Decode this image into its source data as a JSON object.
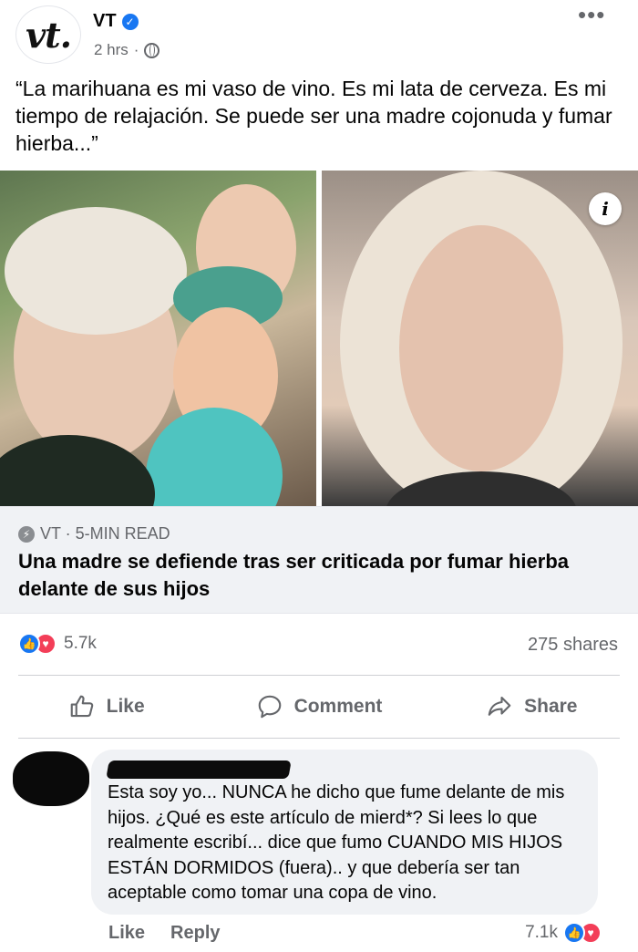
{
  "post": {
    "page_name": "VT",
    "logo_text": "vt.",
    "time": "2 hrs",
    "separator": "·",
    "more": "•••",
    "text": "“La marihuana es mi vaso de vino. Es mi lata de cerveza. Es mi tiempo de relajación. Se puede ser una madre cojonuda y fumar hierba...”"
  },
  "link": {
    "source": "VT · 5-MIN READ",
    "title": "Una madre se defiende tras ser criticada por fumar hierba delante de sus hijos",
    "info": "i"
  },
  "stats": {
    "reactions_count": "5.7k",
    "shares": "275 shares"
  },
  "actions": {
    "like": "Like",
    "comment": "Comment",
    "share": "Share"
  },
  "comment": {
    "text": "Esta soy yo... NUNCA he dicho que fume delante de mis hijos. ¿Qué es este artículo de mierd*? Si lees lo que realmente escribí... dice que fumo CUANDO MIS HIJOS ESTÁN DORMIDOS (fuera).. y que debería ser tan aceptable como tomar una copa de vino.",
    "like": "Like",
    "reply": "Reply",
    "reactions_count": "7.1k"
  },
  "colors": {
    "facebook_blue": "#1877f2",
    "love_red": "#f33e58",
    "secondary_text": "#65676b"
  }
}
